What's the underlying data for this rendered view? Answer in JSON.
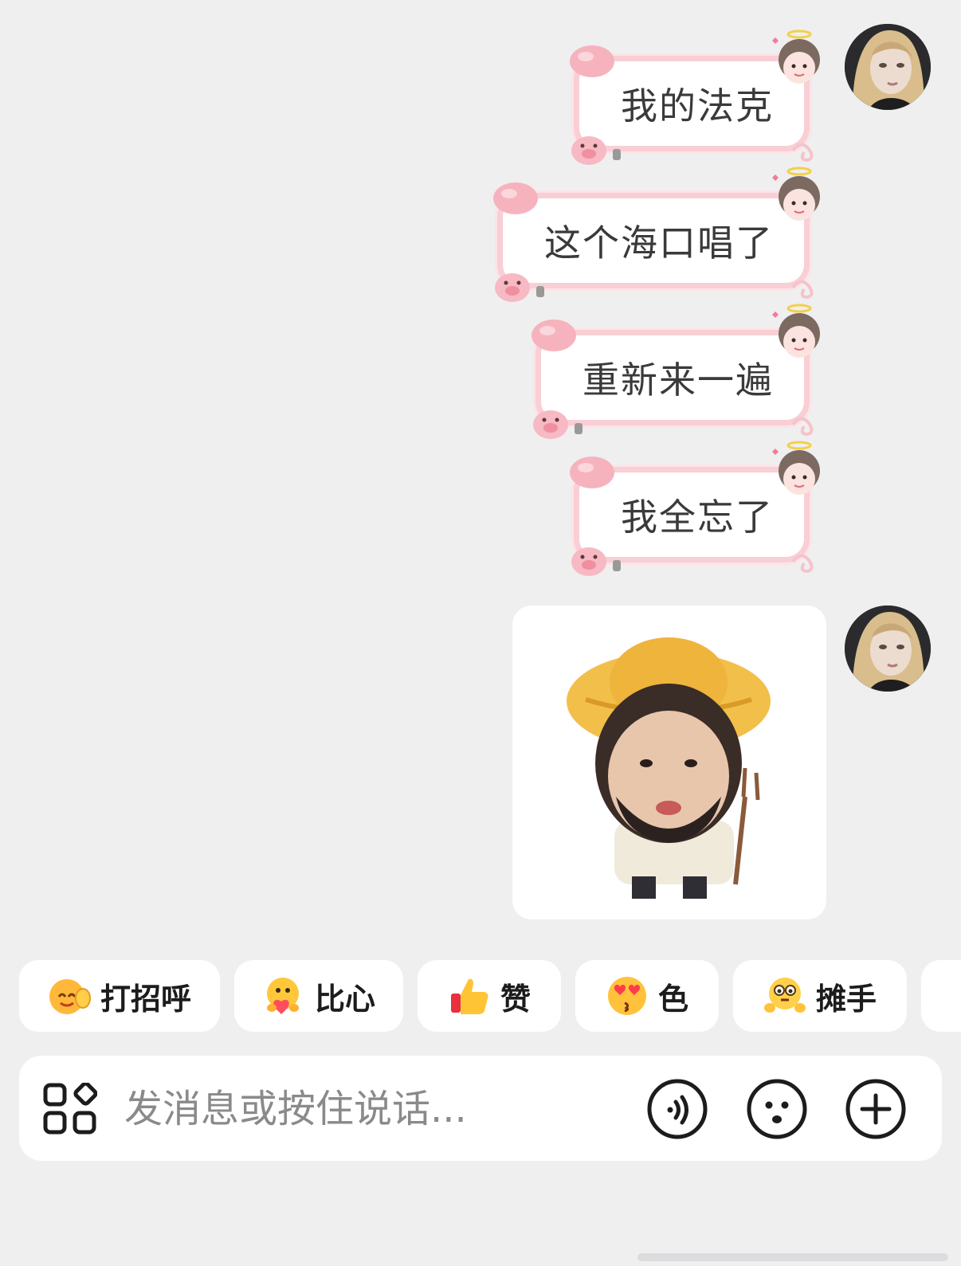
{
  "messages": [
    {
      "text": "我的法克"
    },
    {
      "text": "这个海口唱了"
    },
    {
      "text": "重新来一遍"
    },
    {
      "text": "我全忘了"
    }
  ],
  "sticker": {
    "icon": "farmer-kid-sticker"
  },
  "quick_replies": [
    {
      "emoji": "waving-face-icon",
      "label": "打招呼"
    },
    {
      "emoji": "heart-hug-icon",
      "label": "比心"
    },
    {
      "emoji": "thumbs-up-icon",
      "label": "赞"
    },
    {
      "emoji": "heart-eyes-kiss-icon",
      "label": "色"
    },
    {
      "emoji": "shrug-face-icon",
      "label": "摊手"
    }
  ],
  "input": {
    "placeholder": "发消息或按住说话..."
  },
  "colors": {
    "background": "#efeff0",
    "bubble_border": "#f8cfd5",
    "text": "#3a3a3a"
  }
}
